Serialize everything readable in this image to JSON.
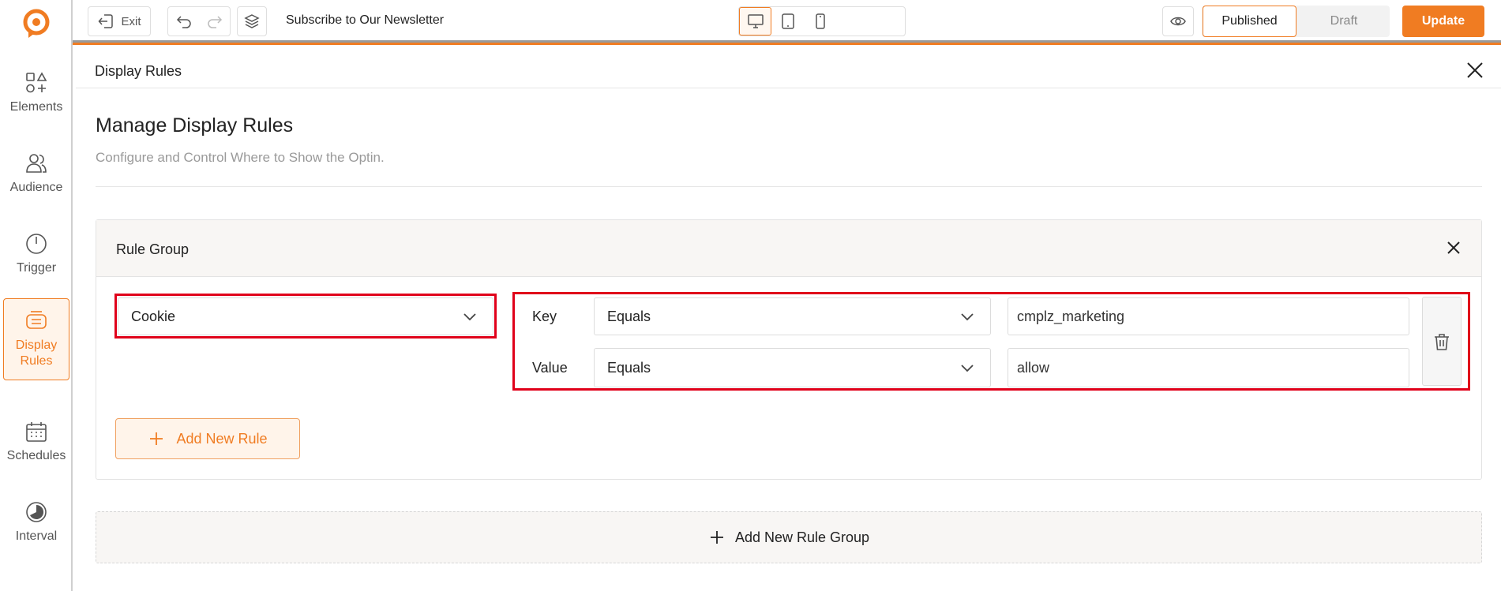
{
  "topbar": {
    "exit_label": "Exit",
    "optin_title": "Subscribe to Our Newsletter",
    "status_published": "Published",
    "status_draft": "Draft",
    "update_label": "Update"
  },
  "sidebar": {
    "items": [
      {
        "label": "Elements",
        "icon": "shapes-icon"
      },
      {
        "label": "Audience",
        "icon": "users-icon"
      },
      {
        "label": "Trigger",
        "icon": "power-icon"
      },
      {
        "label": "Display Rules",
        "icon": "display-rules-icon",
        "active": true
      },
      {
        "label": "Schedules",
        "icon": "calendar-icon"
      },
      {
        "label": "Interval",
        "icon": "clock-pie-icon"
      }
    ]
  },
  "panel": {
    "title": "Display Rules",
    "heading": "Manage Display Rules",
    "subheading": "Configure and Control Where to Show the Optin."
  },
  "rule_group": {
    "title": "Rule Group",
    "rule_type": "Cookie",
    "key_label": "Key",
    "key_operator": "Equals",
    "key_value": "cmplz_marketing",
    "value_label": "Value",
    "value_operator": "Equals",
    "value_value": "allow",
    "add_rule_label": "Add New Rule"
  },
  "add_group_label": "Add New Rule Group",
  "colors": {
    "accent": "#f07c22",
    "highlight": "#e0001a"
  }
}
